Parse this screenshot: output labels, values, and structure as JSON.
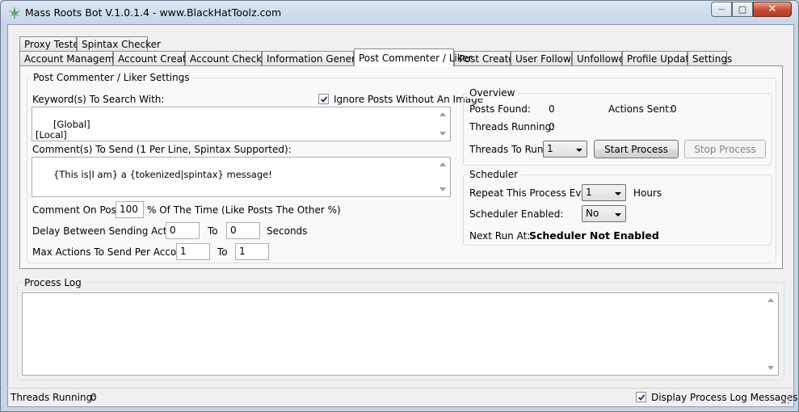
{
  "window": {
    "title": "Mass Roots Bot V.1.0.1.4 - www.BlackHatToolz.com",
    "minimize_glyph": "—",
    "maximize_glyph": "□",
    "close_glyph": "✕"
  },
  "tabs_row1": [
    "Proxy Tester",
    "Spintax Checker"
  ],
  "tabs_row2": [
    "Account Management",
    "Account Creator",
    "Account Checker",
    "Information Generator",
    "Post Commenter / Liker",
    "Post Creator",
    "User Follower",
    "Unfollower",
    "Profile Updater",
    "Settings"
  ],
  "settings": {
    "group_label": "Post Commenter / Liker Settings",
    "keywords_label": "Keyword(s) To Search With:",
    "ignore_posts_label": "Ignore Posts Without An Image",
    "ignore_posts_checked": true,
    "keywords_value": "[Global]\n[Local]",
    "comments_label": "Comment(s) To Send (1 Per Line, Spintax Supported):",
    "comments_value": "{This is|I am} a {tokenized|spintax} message!",
    "comment_on_label": "Comment On Posts:",
    "comment_on_value": "100",
    "comment_on_suffix": "% Of The Time (Like Posts The Other %)",
    "delay_label": "Delay Between Sending Actions:",
    "delay_from": "0",
    "delay_to_label": "To",
    "delay_to": "0",
    "delay_unit": "Seconds",
    "max_actions_label": "Max Actions To Send Per Account:",
    "max_from": "1",
    "max_to_label": "To",
    "max_to": "1"
  },
  "overview": {
    "group_label": "Overview",
    "posts_found_label": "Posts Found:",
    "posts_found_value": "0",
    "actions_sent_label": "Actions Sent:",
    "actions_sent_value": "0",
    "threads_running_label": "Threads Running:",
    "threads_running_value": "0",
    "threads_to_run_label": "Threads To Run:",
    "threads_to_run_value": "1",
    "start_label": "Start Process",
    "stop_label": "Stop Process"
  },
  "scheduler": {
    "group_label": "Scheduler",
    "repeat_label": "Repeat This Process Every",
    "repeat_value": "1",
    "repeat_unit": "Hours",
    "enabled_label": "Scheduler Enabled:",
    "enabled_value": "No",
    "next_run_label": "Next Run At:",
    "next_run_value": "Scheduler Not Enabled"
  },
  "process_log": {
    "group_label": "Process Log",
    "content": ""
  },
  "status_bar": {
    "threads_running_label": "Threads Running:",
    "threads_running_value": "0",
    "display_log_label": "Display Process Log Messages",
    "display_log_checked": true
  },
  "colors": {
    "title_bar": "#c5d5e8",
    "client_bg": "#f0f0f0",
    "tab_panel_bg": "#f9f9f9",
    "close_button": "#c7492f",
    "app_icon": "#3c8c2e"
  }
}
